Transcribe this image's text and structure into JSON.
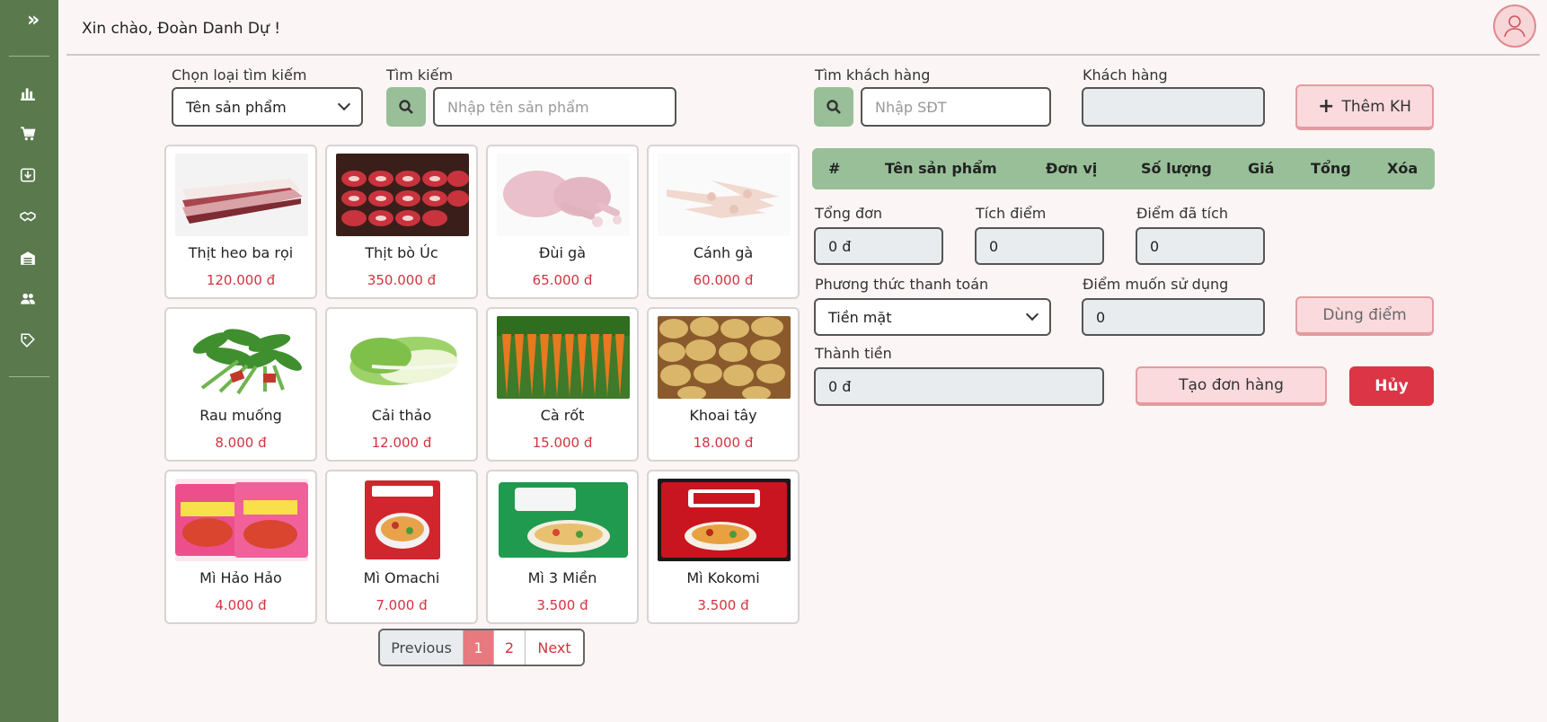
{
  "header": {
    "greeting": "Xin chào, Đoàn Danh Dự !"
  },
  "sidebar": {
    "icons": [
      "expand-icon",
      "chart-icon",
      "cart-icon",
      "import-icon",
      "handshake-icon",
      "warehouse-icon",
      "users-icon",
      "badge-icon"
    ]
  },
  "search": {
    "type_label": "Chọn loại tìm kiếm",
    "type_selected": "Tên sản phẩm",
    "search_label": "Tìm kiếm",
    "search_placeholder": "Nhập tên sản phẩm"
  },
  "products": [
    {
      "name": "Thịt heo ba rọi",
      "price": "120.000 đ"
    },
    {
      "name": "Thịt bò Úc",
      "price": "350.000 đ"
    },
    {
      "name": "Đùi gà",
      "price": "65.000 đ"
    },
    {
      "name": "Cánh gà",
      "price": "60.000 đ"
    },
    {
      "name": "Rau muống",
      "price": "8.000 đ"
    },
    {
      "name": "Cải thảo",
      "price": "12.000 đ"
    },
    {
      "name": "Cà rốt",
      "price": "15.000 đ"
    },
    {
      "name": "Khoai tây",
      "price": "18.000 đ"
    },
    {
      "name": "Mì Hảo Hảo",
      "price": "4.000 đ"
    },
    {
      "name": "Mì Omachi",
      "price": "7.000 đ"
    },
    {
      "name": "Mì 3 Miền",
      "price": "3.500 đ"
    },
    {
      "name": "Mì Kokomi",
      "price": "3.500 đ"
    }
  ],
  "pagination": {
    "prev": "Previous",
    "pages": [
      "1",
      "2"
    ],
    "next": "Next",
    "current": "1"
  },
  "customer": {
    "search_label": "Tìm khách hàng",
    "phone_placeholder": "Nhập SĐT",
    "customer_label": "Khách hàng",
    "customer_value": "",
    "add_label": "Thêm KH"
  },
  "order_table": {
    "headers": [
      "#",
      "Tên sản phẩm",
      "Đơn vị",
      "Số lượng",
      "Giá",
      "Tổng",
      "Xóa"
    ]
  },
  "summary": {
    "total_label": "Tổng đơn",
    "total_value": "0 đ",
    "points_label": "Tích điểm",
    "points_value": "0",
    "accum_label": "Điểm đã tích",
    "accum_value": "0",
    "payment_label": "Phương thức thanh toán",
    "payment_selected": "Tiền mặt",
    "use_points_label": "Điểm muốn sử dụng",
    "use_points_value": "0",
    "use_points_button": "Dùng điểm",
    "amount_label": "Thành tiền",
    "amount_value": "0 đ",
    "create_button": "Tạo đơn hàng",
    "cancel_button": "Hủy"
  },
  "colors": {
    "sidebar": "#5a7a4e",
    "accent_green": "#98bf98",
    "price_red": "#d2333f",
    "cancel_red": "#dc3545",
    "pink": "#fadadd"
  }
}
